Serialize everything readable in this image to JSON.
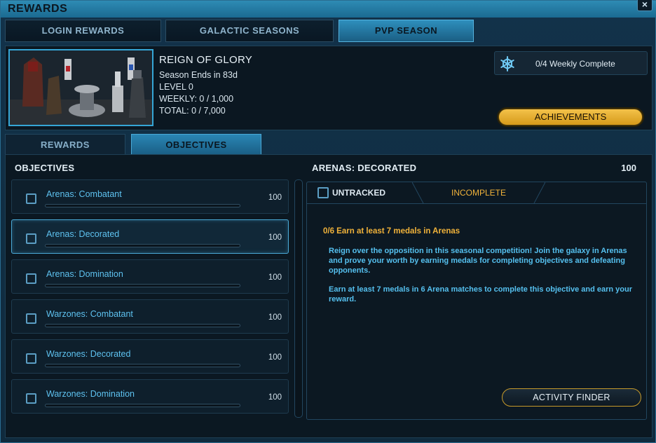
{
  "window": {
    "title": "REWARDS",
    "close_label": "×"
  },
  "top_tabs": [
    {
      "label": "LOGIN REWARDS"
    },
    {
      "label": "GALACTIC SEASONS"
    },
    {
      "label": "PVP SEASON"
    }
  ],
  "season": {
    "title": "REIGN OF GLORY",
    "ends": "Season Ends in 83d",
    "level": "LEVEL 0",
    "weekly": "WEEKLY: 0 / 1,000",
    "total": "TOTAL: 0 / 7,000",
    "weekly_complete": "0/4 Weekly Complete",
    "achievements_label": "ACHIEVEMENTS"
  },
  "sub_tabs": [
    {
      "label": "REWARDS"
    },
    {
      "label": "OBJECTIVES"
    }
  ],
  "objectives": {
    "heading": "OBJECTIVES",
    "items": [
      {
        "name": "Arenas: Combatant",
        "points": "100",
        "progress": 0
      },
      {
        "name": "Arenas: Decorated",
        "points": "100",
        "progress": 0
      },
      {
        "name": "Arenas: Domination",
        "points": "100",
        "progress": 0
      },
      {
        "name": "Warzones: Combatant",
        "points": "100",
        "progress": 0
      },
      {
        "name": "Warzones: Decorated",
        "points": "100",
        "progress": 0
      },
      {
        "name": "Warzones: Domination",
        "points": "100",
        "progress": 0
      }
    ]
  },
  "detail": {
    "title": "ARENAS: DECORATED",
    "points": "100",
    "track_label": "UNTRACKED",
    "status": "INCOMPLETE",
    "progress_text": "0/6 Earn at least 7 medals in Arenas",
    "description_1": "Reign over the opposition in this seasonal competition! Join the galaxy in Arenas and prove your worth by earning medals for completing objectives and defeating opponents.",
    "description_2": "Earn at least 7 medals in 6 Arena matches to complete this objective and earn your reward.",
    "activity_finder_label": "ACTIVITY FINDER"
  },
  "colors": {
    "accent": "#5ec2f0",
    "status": "#f0b23a",
    "achievement_button": "#e6ae2c"
  },
  "icons": {
    "weekly": "weekly-snowflake-icon",
    "close": "close-icon"
  }
}
